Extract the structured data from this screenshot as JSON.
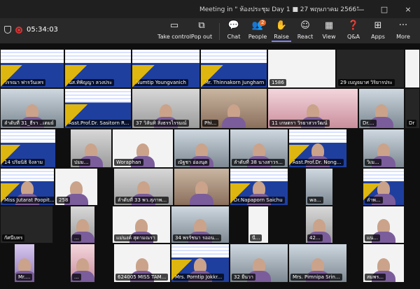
{
  "window": {
    "title": "Meeting in \" ห้องประชุม Day 1 ■ 27 พฤษภาคม 2566\"",
    "controls": [
      "—",
      "□",
      "×"
    ]
  },
  "recording": {
    "timer": "05:34:03"
  },
  "toolbar": {
    "buttons": [
      {
        "label": "Take control",
        "icon": "take-control-icon",
        "glyph": "▭"
      },
      {
        "label": "Pop out",
        "icon": "pop-out-icon",
        "glyph": "⧉"
      },
      {
        "label": "Chat",
        "icon": "chat-icon",
        "glyph": "💬"
      },
      {
        "label": "People",
        "icon": "people-icon",
        "glyph": "👥",
        "badge": "2"
      },
      {
        "label": "Raise",
        "icon": "raise-hand-icon",
        "glyph": "✋"
      },
      {
        "label": "React",
        "icon": "react-icon",
        "glyph": "☺"
      },
      {
        "label": "View",
        "icon": "view-icon",
        "glyph": "▦"
      },
      {
        "label": "Q&A",
        "icon": "qa-icon",
        "glyph": "❓"
      },
      {
        "label": "Apps",
        "icon": "apps-icon",
        "glyph": "⊞"
      },
      {
        "label": "More",
        "icon": "more-icon",
        "glyph": "···"
      }
    ]
  },
  "participants": {
    "row1": [
      "วรรณา ฟารวันเทร",
      "นส.ทิพิญญา ลวงประ",
      "Numtip Youngvanich",
      "Mr. Thinnakorn Jungharn",
      "1586",
      "29 เบญจมาศ วิริยารประ",
      "Dr"
    ],
    "row2": [
      "ลำดับที่ 31_ธีรา ..เตมย์",
      "Asst.Prof.Dr. Sasitorn R...",
      "37 วิลันทิ สิ่งธรรไรรมณ์",
      "Phi...",
      "11 เกษตรา วิรยาสวรวัฒน์",
      "Dr...."
    ],
    "row3": [
      "14 ปริยนิธิ จิงลาม",
      "ปมม...",
      "Woraphan",
      "ณัฐชา อ่องนุต",
      "ลำดับที่ 38 นางสาวร...",
      "Asst.Prof.Dr. Nong...",
      "วิเม..."
    ],
    "row4": [
      "Miss Jutarat Poopitu...",
      "258",
      "ลำดับที่ 33 พว.สุภาพ...",
      "Dr.Napaporn Saichu",
      "wa...",
      "ลำพ..."
    ],
    "row5": [
      "กัศนีบทร",
      "...",
      "แม่นงค์ สุดามณรา",
      "34 พรรัชนา รออน...",
      "นี...",
      "42...",
      "แน..."
    ],
    "row6": [
      "Mr....",
      "...",
      "624005 MISS TAM...",
      "Mrs. Porntip Jokkr...",
      "32 ยืนวา",
      "Mrs. Pimnipa Srin...",
      "สมพร..."
    ]
  }
}
